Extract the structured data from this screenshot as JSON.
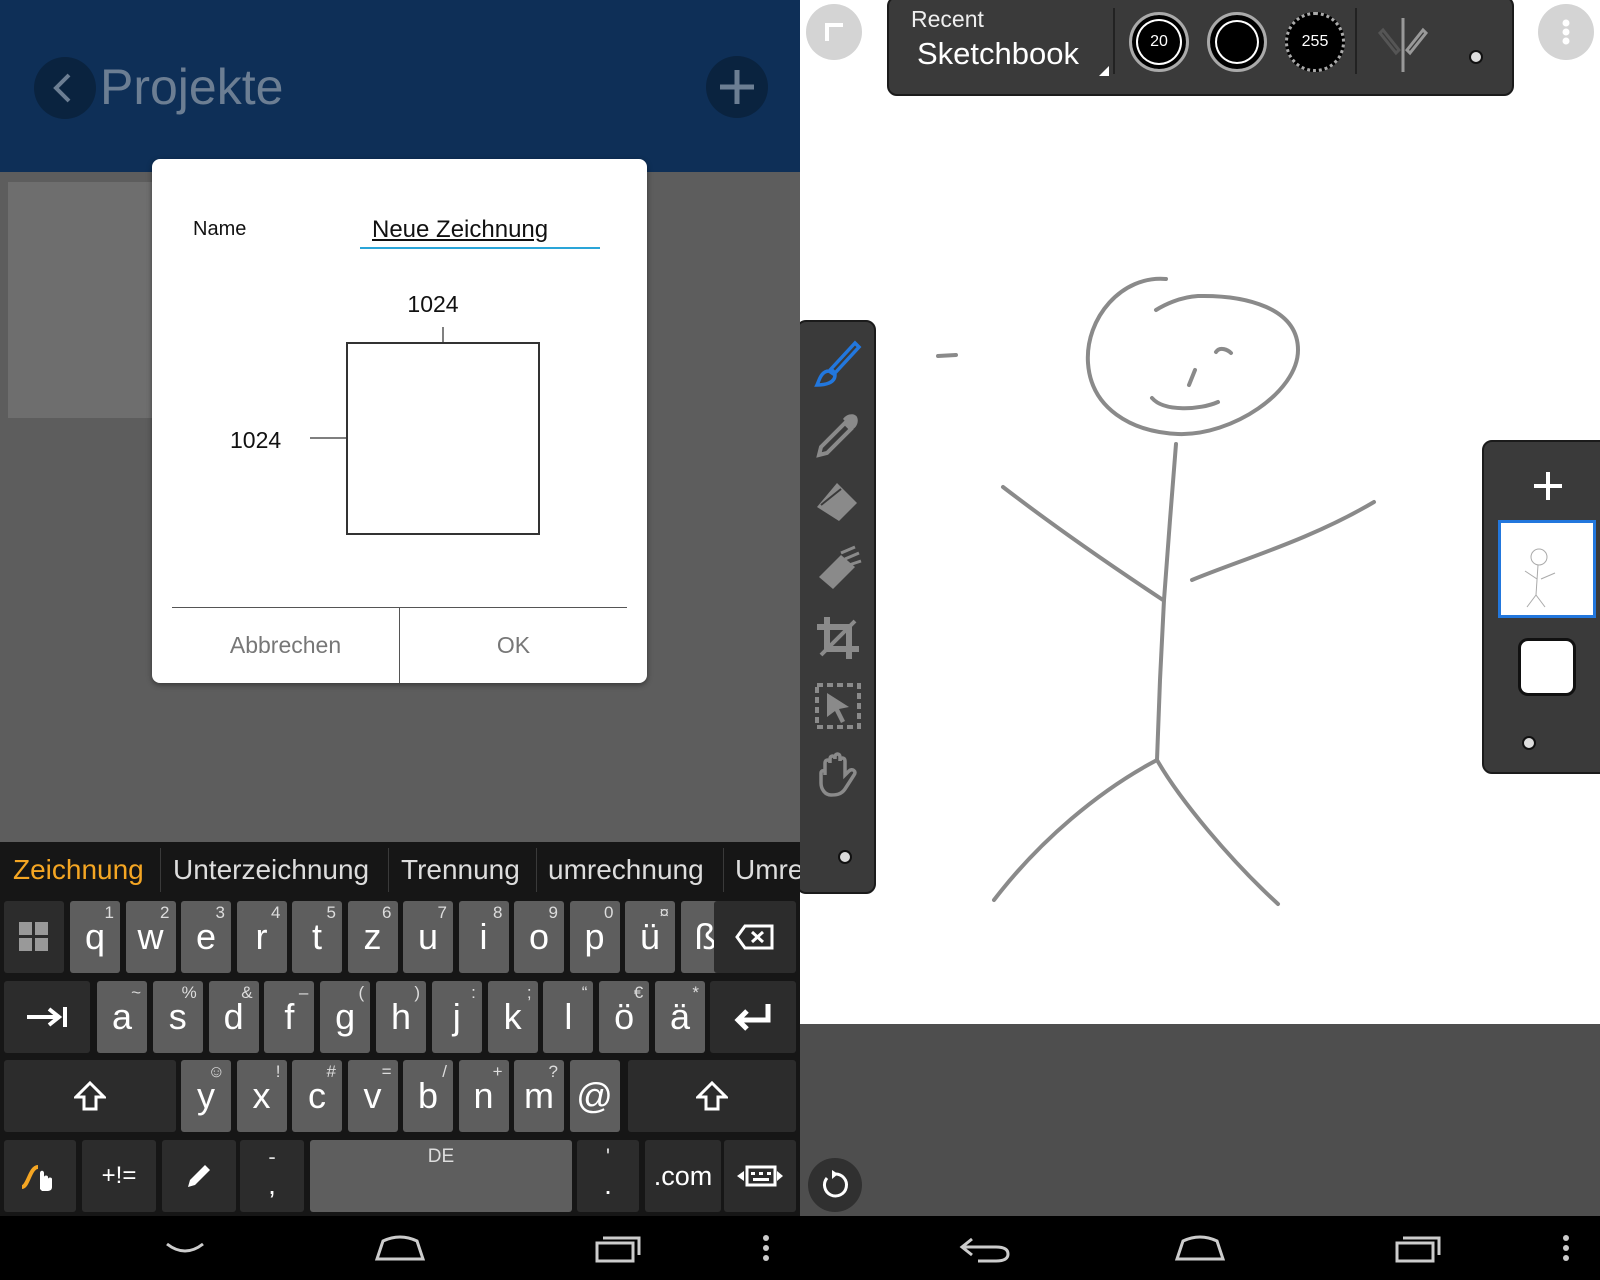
{
  "left": {
    "header": {
      "title": "Projekte"
    },
    "dialog": {
      "name_label": "Name",
      "name_value": "Neue Zeichnung",
      "width": "1024",
      "height": "1024",
      "cancel_label": "Abbrechen",
      "ok_label": "OK"
    },
    "suggestions": [
      "Zeichnung",
      "Unterzeichnung",
      "Trennung",
      "umrechnung",
      "Umre"
    ],
    "keyboard": {
      "row1": [
        {
          "k": "q",
          "h": "1"
        },
        {
          "k": "w",
          "h": "2"
        },
        {
          "k": "e",
          "h": "3"
        },
        {
          "k": "r",
          "h": "4"
        },
        {
          "k": "t",
          "h": "5"
        },
        {
          "k": "z",
          "h": "6"
        },
        {
          "k": "u",
          "h": "7"
        },
        {
          "k": "i",
          "h": "8"
        },
        {
          "k": "o",
          "h": "9"
        },
        {
          "k": "p",
          "h": "0"
        },
        {
          "k": "ü",
          "h": "¤"
        },
        {
          "k": "ß",
          "h": "¬"
        }
      ],
      "row2": [
        {
          "k": "a",
          "h": "~"
        },
        {
          "k": "s",
          "h": "%"
        },
        {
          "k": "d",
          "h": "&"
        },
        {
          "k": "f",
          "h": "–"
        },
        {
          "k": "g",
          "h": "("
        },
        {
          "k": "h",
          "h": ")"
        },
        {
          "k": "j",
          "h": ":"
        },
        {
          "k": "k",
          "h": ";"
        },
        {
          "k": "l",
          "h": "“"
        },
        {
          "k": "ö",
          "h": "€"
        },
        {
          "k": "ä",
          "h": "*"
        }
      ],
      "row3": [
        {
          "k": "y",
          "h": "☺"
        },
        {
          "k": "x",
          "h": "!"
        },
        {
          "k": "c",
          "h": "#"
        },
        {
          "k": "v",
          "h": "="
        },
        {
          "k": "b",
          "h": "/"
        },
        {
          "k": "n",
          "h": "+"
        },
        {
          "k": "m",
          "h": "?"
        },
        {
          "k": "@",
          "h": ""
        }
      ],
      "symbols_label": "+!=",
      "comma_hint": "-",
      "comma_label": ",",
      "space_label": "DE",
      "period_hint": "'",
      "period_label": ".",
      "dotcom_label": ".com"
    }
  },
  "right": {
    "toolbar": {
      "recent_label": "Recent",
      "brush_name": "Sketchbook",
      "size_value": "20",
      "opacity_value": "255"
    },
    "tools": [
      "brush-tool",
      "eyedropper-tool",
      "fill-tool",
      "eraser-tool",
      "crop-tool",
      "select-tool",
      "hand-tool"
    ],
    "layers": {
      "count": 2
    }
  },
  "colors": {
    "accent": "#2277dd",
    "suggestion_highlight": "#f5a623",
    "header": "#0e2f57"
  }
}
